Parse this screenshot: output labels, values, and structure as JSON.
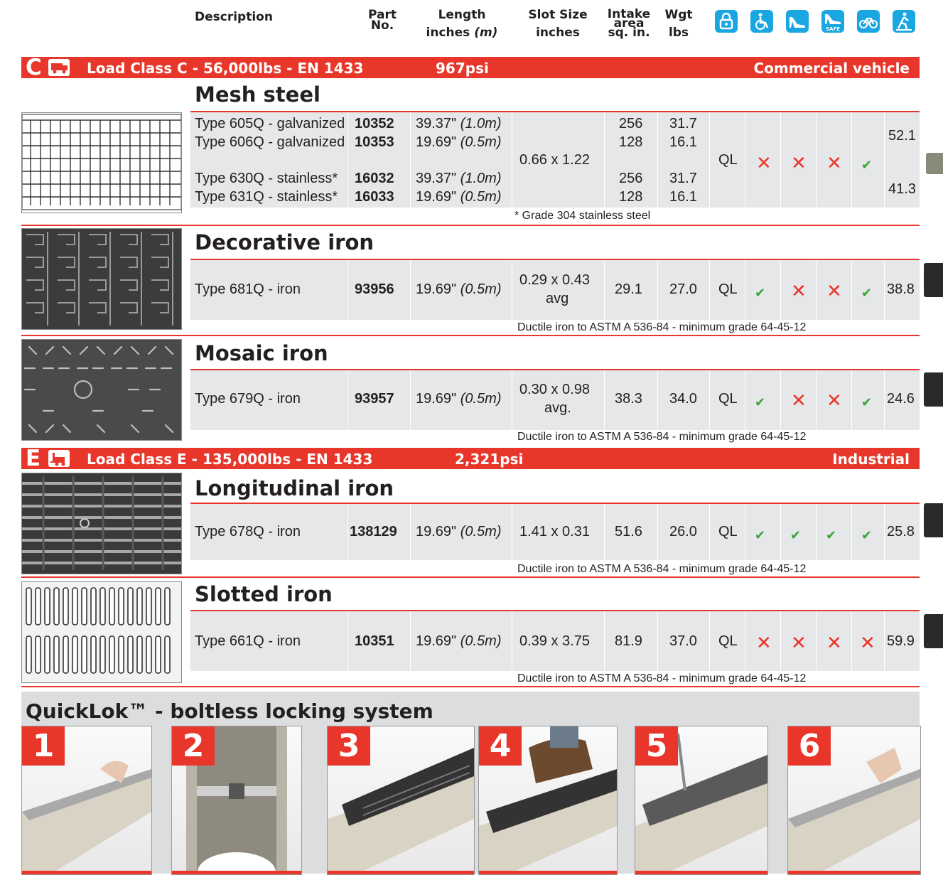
{
  "header": {
    "description": "Description",
    "part_no_1": "Part",
    "part_no_2": "No.",
    "length_1": "Length",
    "length_2": "inches",
    "length_3": "(m)",
    "slot_1": "Slot Size",
    "slot_2": "inches",
    "intake_1": "Intake",
    "intake_2": "area",
    "intake_3": "sq. in.",
    "wgt_1": "Wgt",
    "wgt_2": "lbs",
    "icons": [
      "lock-icon",
      "wheelchair-icon",
      "heel-icon",
      "heelsafe-icon",
      "bicycle-icon",
      "pedestrian-icon"
    ],
    "icon_color": "#1aa6e0",
    "icon_safe_text": "SAFE"
  },
  "class_c": {
    "letter": "C",
    "title": "Load Class C - 56,000lbs - EN 1433",
    "psi": "967psi",
    "usage": "Commercial vehicle"
  },
  "class_e": {
    "letter": "E",
    "title": "Load Class E - 135,000lbs - EN 1433",
    "psi": "2,321psi",
    "usage": "Industrial"
  },
  "accent_color": "#e9362a",
  "mesh": {
    "title": "Mesh steel",
    "rows": [
      {
        "desc": "Type 605Q - galvanized",
        "part": "10352",
        "len": "39.37\"",
        "m": "(1.0m)",
        "area": "256",
        "wgt": "31.7"
      },
      {
        "desc": "Type 606Q - galvanized",
        "part": "10353",
        "len": "19.69\"",
        "m": "(0.5m)",
        "area": "128",
        "wgt": "16.1"
      },
      {
        "desc": "Type 630Q - stainless*",
        "part": "16032",
        "len": "39.37\"",
        "m": "(1.0m)",
        "area": "256",
        "wgt": "31.7"
      },
      {
        "desc": "Type 631Q - stainless*",
        "part": "16033",
        "len": "19.69\"",
        "m": "(0.5m)",
        "area": "128",
        "wgt": "16.1"
      }
    ],
    "slot": "0.66 x 1.22",
    "ql": "QL",
    "price_1": "52.1",
    "price_2": "41.3",
    "note": "* Grade 304 stainless steel"
  },
  "decorative": {
    "title": "Decorative iron",
    "desc": "Type 681Q - iron",
    "part": "93956",
    "len": "19.69\"",
    "m": "(0.5m)",
    "slot_1": "0.29 x 0.43",
    "slot_2": "avg",
    "area": "29.1",
    "wgt": "27.0",
    "ql": "QL",
    "price": "38.8",
    "note": "Ductile iron to ASTM A 536-84 - minimum grade 64-45-12"
  },
  "mosaic": {
    "title": "Mosaic iron",
    "desc": "Type 679Q - iron",
    "part": "93957",
    "len": "19.69\"",
    "m": "(0.5m)",
    "slot_1": "0.30 x 0.98",
    "slot_2": "avg.",
    "area": "38.3",
    "wgt": "34.0",
    "ql": "QL",
    "price": "24.6",
    "note": "Ductile iron to ASTM A 536-84 - minimum grade 64-45-12"
  },
  "longitudinal": {
    "title": "Longitudinal iron",
    "desc": "Type 678Q - iron",
    "part": "138129",
    "len": "19.69\"",
    "m": "(0.5m)",
    "slot": "1.41 x 0.31",
    "area": "51.6",
    "wgt": "26.0",
    "ql": "QL",
    "price": "25.8",
    "note": "Ductile iron to ASTM A 536-84 - minimum grade 64-45-12"
  },
  "slotted": {
    "title": "Slotted iron",
    "desc": "Type 661Q - iron",
    "part": "10351",
    "len": "19.69\"",
    "m": "(0.5m)",
    "slot": "0.39 x 3.75",
    "area": "81.9",
    "wgt": "37.0",
    "ql": "QL",
    "price": "59.9",
    "note": "Ductile iron to ASTM A 536-84 - minimum grade 64-45-12"
  },
  "quicklok": {
    "title": "QuickLok™ - boltless locking system",
    "steps": [
      "1",
      "2",
      "3",
      "4",
      "5",
      "6"
    ]
  },
  "marks": {
    "check": "✔",
    "cross": "✕"
  }
}
